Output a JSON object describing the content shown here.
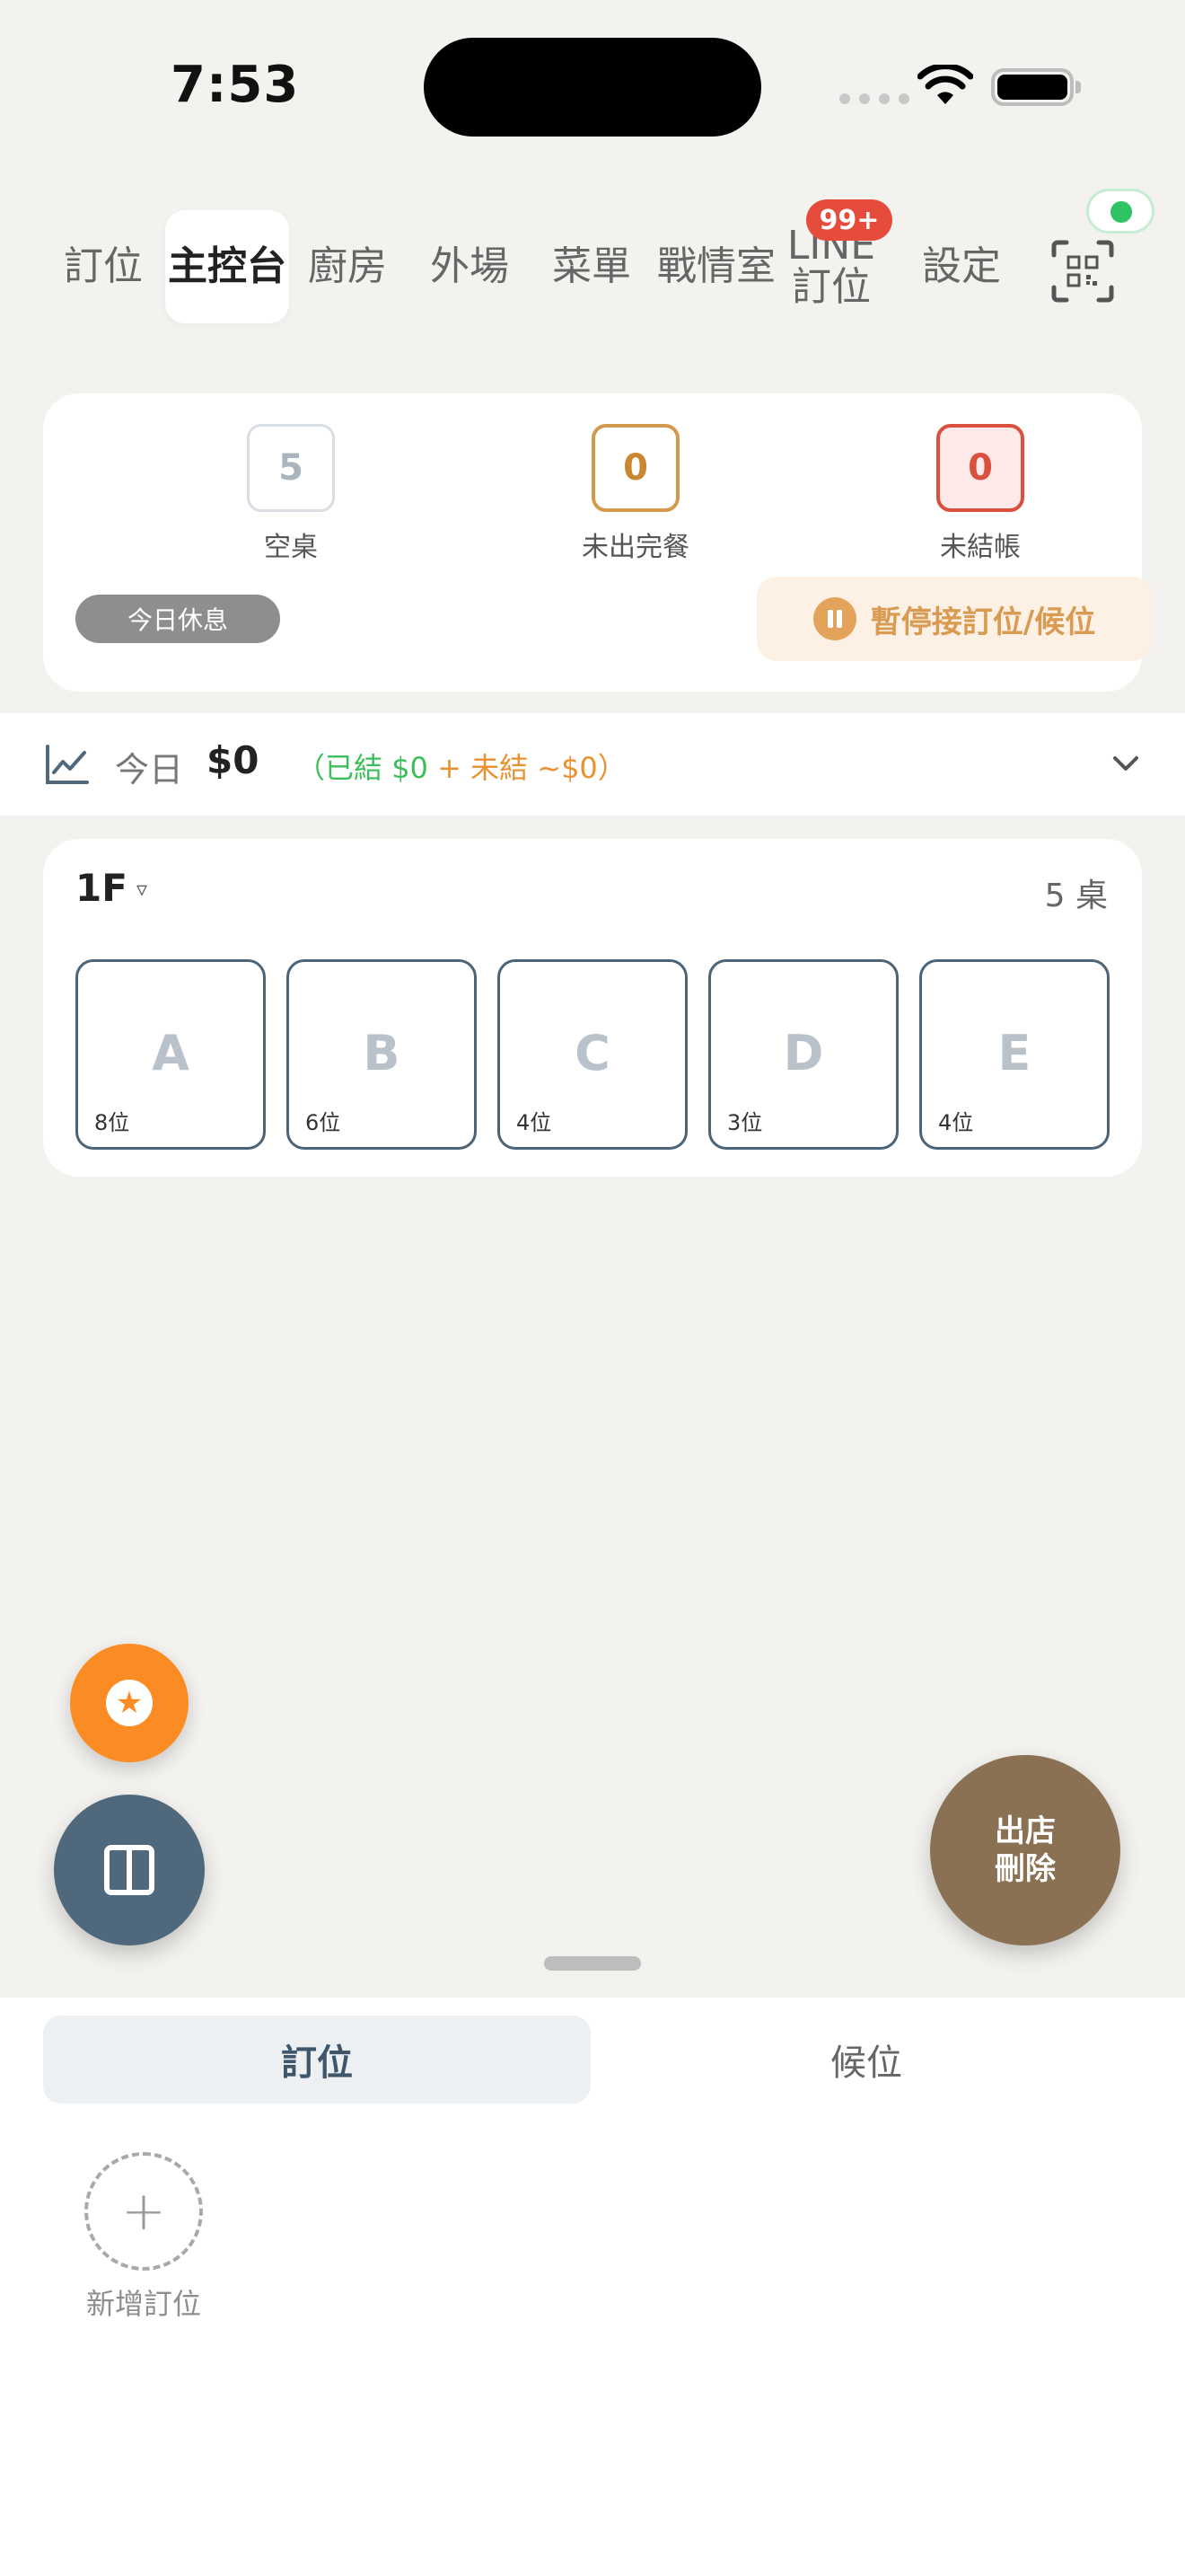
{
  "status_bar": {
    "time": "7:53"
  },
  "nav": {
    "items": [
      {
        "label": "訂位"
      },
      {
        "label": "主控台"
      },
      {
        "label": "廚房"
      },
      {
        "label": "外場"
      },
      {
        "label": "菜單"
      },
      {
        "label": "戰情室"
      },
      {
        "label_line1": "LINE",
        "label_line2": "訂位",
        "badge": "99+"
      },
      {
        "label": "設定"
      }
    ],
    "active": "主控台"
  },
  "summary": {
    "empty_tables": {
      "value": "5",
      "label": "空桌"
    },
    "unserved": {
      "value": "0",
      "label": "未出完餐"
    },
    "unpaid": {
      "value": "0",
      "label": "未結帳"
    },
    "closed_chip": "今日休息",
    "pause_button": "暫停接訂位/候位"
  },
  "revenue": {
    "label": "今日",
    "amount": "$0",
    "open_paren": "（",
    "settled": "已結 $0",
    "plus": " + ",
    "unsettled": "未結 ~$0",
    "close_paren": "）"
  },
  "floor": {
    "name": "1F",
    "arrow": "▿",
    "count": "5 桌",
    "tables": [
      {
        "name": "A",
        "seats": "8位"
      },
      {
        "name": "B",
        "seats": "6位"
      },
      {
        "name": "C",
        "seats": "4位"
      },
      {
        "name": "D",
        "seats": "3位"
      },
      {
        "name": "E",
        "seats": "4位"
      }
    ]
  },
  "fab": {
    "checkout_line1": "出店",
    "checkout_line2": "刪除",
    "star": "★"
  },
  "bottom": {
    "tabs": [
      {
        "label": "訂位"
      },
      {
        "label": "候位"
      }
    ],
    "add_icon": "+",
    "add_label": "新增訂位"
  },
  "colors": {
    "accent_orange": "#fb8c24",
    "slate": "#4f687c",
    "brown": "#8a7154",
    "danger": "#d9503f",
    "success": "#2ec466"
  }
}
